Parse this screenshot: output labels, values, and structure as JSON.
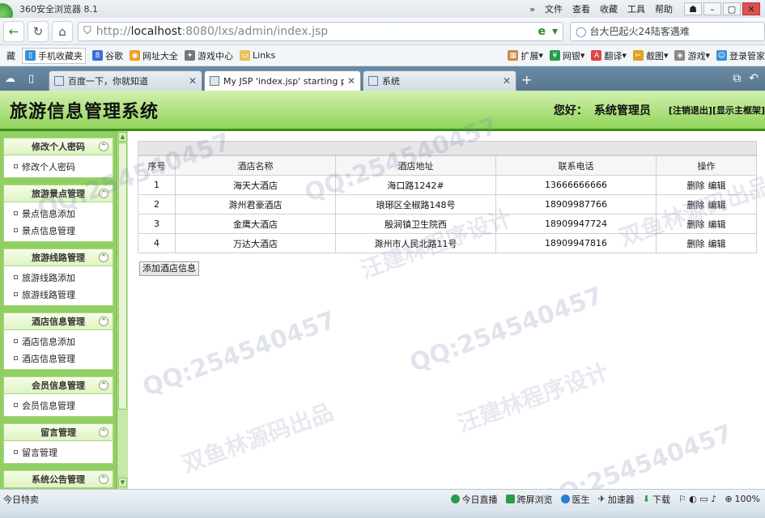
{
  "browser": {
    "app_title": "360安全浏览器 8.1",
    "menus": [
      "文件",
      "查看",
      "收藏",
      "工具",
      "帮助"
    ],
    "url_scheme": "http://",
    "url_host": "localhost",
    "url_rest": ":8080/lxs/admin/index.jsp",
    "search_text": "台大巴起火24陆客遇难",
    "favorites": [
      {
        "label": "藏",
        "icon": "star-icon"
      },
      {
        "label": "手机收藏夹",
        "icon": "phone-icon"
      },
      {
        "label": "谷歌",
        "icon": "google-icon"
      },
      {
        "label": "网址大全",
        "icon": "globe-icon"
      },
      {
        "label": "游戏中心",
        "icon": "gamepad-icon"
      },
      {
        "label": "Links",
        "icon": "folder-icon"
      }
    ],
    "favorites_right": [
      "扩展",
      "网银",
      "翻译",
      "截图",
      "游戏",
      "登录管家"
    ],
    "tabs": [
      {
        "label": "百度一下，你就知道",
        "active": false
      },
      {
        "label": "My JSP 'index.jsp' starting p",
        "active": true
      },
      {
        "label": "系统",
        "active": false
      }
    ],
    "status_left": "今日特卖",
    "status_items": [
      "今日直播",
      "跨屏浏览",
      "医生",
      "加速器",
      "下载"
    ],
    "zoom": "100%"
  },
  "header": {
    "system_name": "旅游信息管理系统",
    "greeting_prefix": "您好：",
    "user": "系统管理员",
    "logout_link": "[注销退出]",
    "show_frame_link": "[显示主框架]"
  },
  "sidebar": [
    {
      "title": "修改个人密码",
      "items": [
        "修改个人密码"
      ]
    },
    {
      "title": "旅游景点管理",
      "items": [
        "景点信息添加",
        "景点信息管理"
      ]
    },
    {
      "title": "旅游线路管理",
      "items": [
        "旅游线路添加",
        "旅游线路管理"
      ]
    },
    {
      "title": "酒店信息管理",
      "items": [
        "酒店信息添加",
        "酒店信息管理"
      ]
    },
    {
      "title": "会员信息管理",
      "items": [
        "会员信息管理"
      ]
    },
    {
      "title": "留言管理",
      "items": [
        "留言管理"
      ]
    },
    {
      "title": "系统公告管理",
      "items": []
    }
  ],
  "table": {
    "columns": [
      "序号",
      "酒店名称",
      "酒店地址",
      "联系电话",
      "操作"
    ],
    "rows": [
      [
        "1",
        "海天大酒店",
        "海口路1242#",
        "13666666666"
      ],
      [
        "2",
        "滁州君豪酒店",
        "琅琊区全椒路148号",
        "18909987766"
      ],
      [
        "3",
        "金鹰大酒店",
        "殷涧镇卫生院西",
        "18909947724"
      ],
      [
        "4",
        "万达大酒店",
        "滁州市人民北路11号",
        "18909947816"
      ]
    ],
    "delete_label": "删除",
    "edit_label": "编辑"
  },
  "add_button": "添加酒店信息",
  "watermarks": [
    "QQ:254540457",
    "汪建林程序设计",
    "双鱼林源码出品"
  ]
}
